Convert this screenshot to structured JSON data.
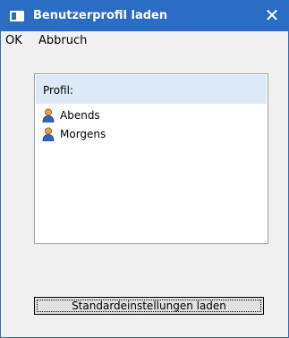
{
  "window": {
    "title": "Benutzerprofil laden",
    "close_glyph": "✕",
    "accent_color": "#2b6cc4"
  },
  "menu": {
    "items": [
      {
        "label": "OK"
      },
      {
        "label": "Abbruch"
      }
    ]
  },
  "profile_list": {
    "header": "Profil:",
    "header_color": "#dce9f6",
    "items": [
      {
        "label": "Abends",
        "icon": "user-icon"
      },
      {
        "label": "Morgens",
        "icon": "user-icon"
      }
    ]
  },
  "buttons": {
    "reset_label": "Standardeinstellungen laden"
  }
}
